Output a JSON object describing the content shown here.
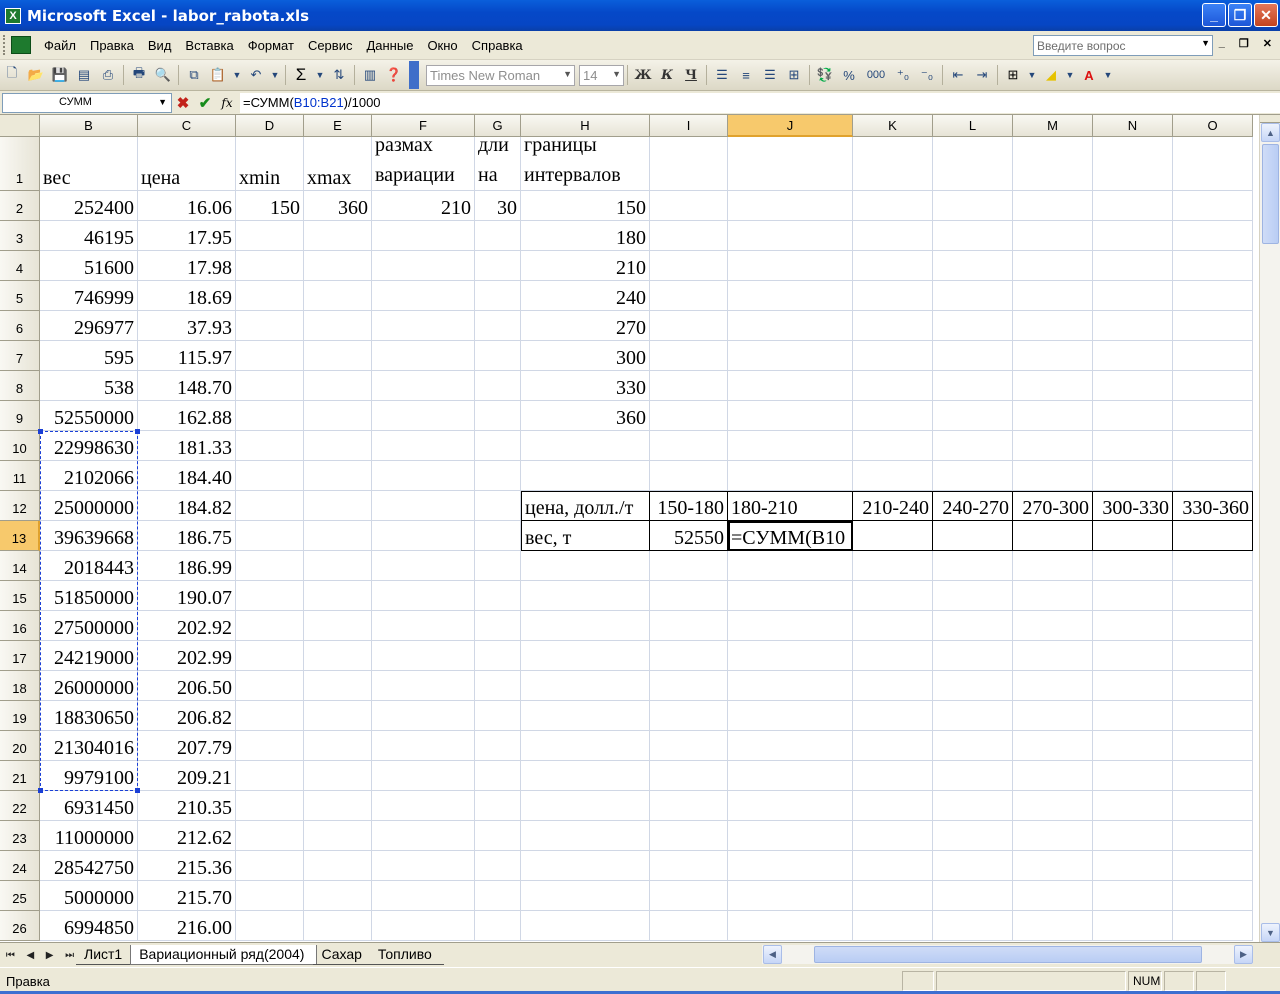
{
  "window": {
    "title": "Microsoft Excel - labor_rabota.xls"
  },
  "menu": {
    "items": [
      "Файл",
      "Правка",
      "Вид",
      "Вставка",
      "Формат",
      "Сервис",
      "Данные",
      "Окно",
      "Справка"
    ],
    "help_placeholder": "Введите вопрос"
  },
  "toolbar": {
    "font": "Times New Roman",
    "size": "14",
    "bold": "Ж",
    "italic": "К",
    "underline": "Ч",
    "percent": "%",
    "thousands": "000",
    "sum": "Σ"
  },
  "formula_bar": {
    "name_box": "СУММ",
    "formula_prefix": "=СУММ(",
    "formula_ref": "B10:B21",
    "formula_suffix": ")/1000"
  },
  "columns": [
    "B",
    "C",
    "D",
    "E",
    "F",
    "G",
    "H",
    "I",
    "J",
    "K",
    "L",
    "M",
    "N",
    "O"
  ],
  "rows": [
    "1",
    "2",
    "3",
    "4",
    "5",
    "6",
    "7",
    "8",
    "9",
    "10",
    "11",
    "12",
    "13",
    "14",
    "15",
    "16",
    "17",
    "18",
    "19",
    "20",
    "21",
    "22",
    "23",
    "24",
    "25",
    "26"
  ],
  "active": {
    "column": "J",
    "row": "13"
  },
  "headers_row1": {
    "B": "вес",
    "C": "цена",
    "D": "xmin",
    "E": "xmax",
    "F1": "размах",
    "F2": "вариации",
    "G1": "дли",
    "G2": "на",
    "H1": "границы",
    "H2": "интервалов"
  },
  "row2": {
    "B": "252400",
    "C": "16.06",
    "D": "150",
    "E": "360",
    "F": "210",
    "G": "30",
    "H": "150"
  },
  "col_B": [
    "46195",
    "51600",
    "746999",
    "296977",
    "595",
    "538",
    "52550000",
    "22998630",
    "2102066",
    "25000000",
    "39639668",
    "2018443",
    "51850000",
    "27500000",
    "24219000",
    "26000000",
    "18830650",
    "21304016",
    "9979100",
    "6931450",
    "11000000",
    "28542750",
    "5000000",
    "6994850"
  ],
  "col_C": [
    "17.95",
    "17.98",
    "18.69",
    "37.93",
    "115.97",
    "148.70",
    "162.88",
    "181.33",
    "184.40",
    "184.82",
    "186.75",
    "186.99",
    "190.07",
    "202.92",
    "202.99",
    "206.50",
    "206.82",
    "207.79",
    "209.21",
    "210.35",
    "212.62",
    "215.36",
    "215.70",
    "216.00"
  ],
  "col_H": [
    "180",
    "210",
    "240",
    "270",
    "300",
    "330",
    "360"
  ],
  "table12": {
    "H": "цена, долл./т",
    "I": "150-180",
    "J": "180-210",
    "K": "210-240",
    "L": "240-270",
    "M": "270-300",
    "N": "300-330",
    "O": "330-360"
  },
  "table13": {
    "H": "вес, т",
    "I": "52550",
    "J": "=СУММ(B10"
  },
  "tabs": [
    "Лист1",
    "Вариационный ряд(2004)",
    "Сахар",
    "Топливо"
  ],
  "status": {
    "mode": "Правка",
    "num": "NUM"
  }
}
